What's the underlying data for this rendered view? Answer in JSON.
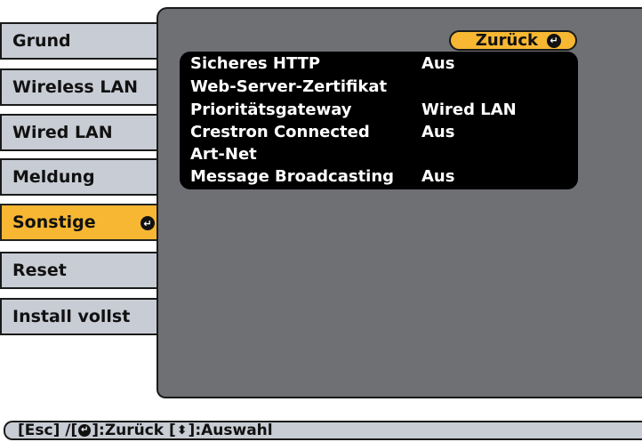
{
  "menu": {
    "items": [
      {
        "label": "Grund"
      },
      {
        "label": "Wireless LAN"
      },
      {
        "label": "Wired LAN"
      },
      {
        "label": "Meldung"
      },
      {
        "label": "Sonstige",
        "selected": true
      },
      {
        "label": "Reset"
      },
      {
        "label": "Install vollst"
      }
    ]
  },
  "panel": {
    "back_label": "Zurück",
    "settings": [
      {
        "label": "Sicheres HTTP",
        "value": "Aus"
      },
      {
        "label": "Web-Server-Zertifikat",
        "value": ""
      },
      {
        "label": "Prioritätsgateway",
        "value": "Wired LAN"
      },
      {
        "label": "Crestron Connected",
        "value": "Aus"
      },
      {
        "label": "Art-Net",
        "value": ""
      },
      {
        "label": "Message Broadcasting",
        "value": "Aus"
      }
    ]
  },
  "status_bar": {
    "esc_text": "[Esc] /[",
    "back_text": "]:Zurück  [",
    "select_text": "]:Auswahl"
  },
  "icons": {
    "enter": "enter-icon",
    "updown": "up-down-arrow-icon"
  },
  "colors": {
    "highlight": "#f7b733",
    "menu_bg": "#c8ccd4",
    "panel_bg": "#6e7074",
    "list_bg": "#000000"
  }
}
